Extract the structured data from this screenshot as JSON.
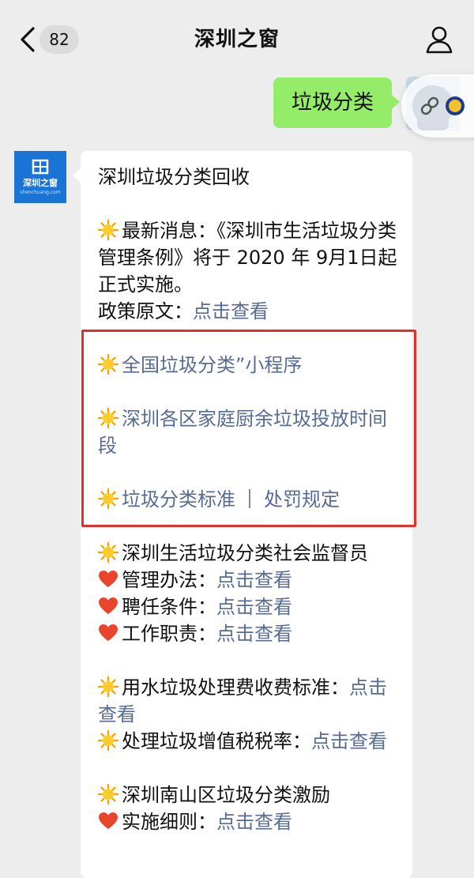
{
  "nav": {
    "badge_count": "82",
    "title": "深圳之窗"
  },
  "outgoing": {
    "text": "垃圾分类"
  },
  "sender": {
    "avatar_name": "深圳之窗",
    "avatar_sub": "shenchuang.com"
  },
  "message": {
    "heading": "深圳垃圾分类回收",
    "news_label": "最新消息：《深圳市生活垃圾分类管理条例》将于 2020 年 9月1日起正式实施。",
    "policy_label": "政策原文：",
    "link_view": "点击查看",
    "mini_program": "全国垃圾分类”小程序",
    "kitchen_waste": "深圳各区家庭厨余垃圾投放时间段",
    "standard": "垃圾分类标准",
    "separator": "｜",
    "penalty": "处罚规定",
    "supervisor": "深圳生活垃圾分类社会监督员",
    "mgmt_label": "管理办法：",
    "hire_label": "聘任条件：",
    "duty_label": "工作职责：",
    "water_fee": "用水垃圾处理费收费标准：",
    "vat_label": "处理垃圾增值税税率：",
    "nanshan": "深圳南山区垃圾分类激励",
    "rules_label": "实施细则："
  },
  "colors": {
    "link": "#576b95",
    "outgoing_bubble": "#95ec69",
    "highlight_box": "#e2312a",
    "background": "#ededed"
  }
}
